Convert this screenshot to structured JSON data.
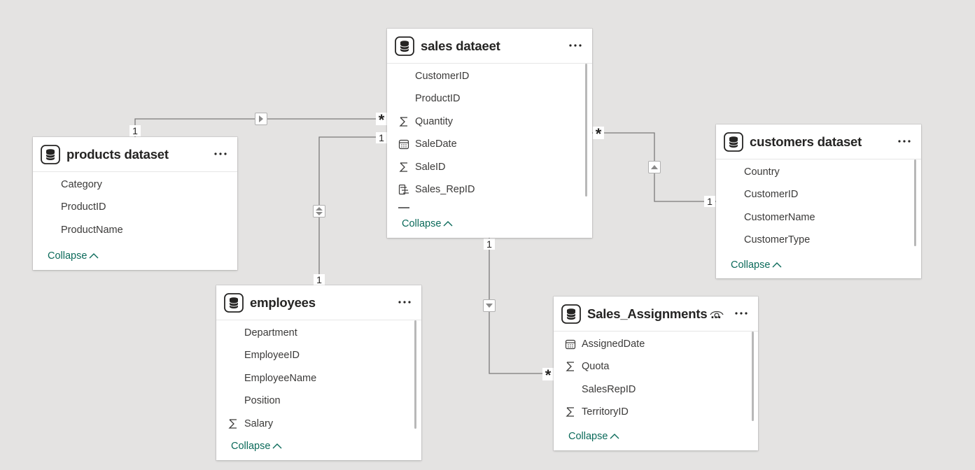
{
  "tables": {
    "products": {
      "title": "products dataset",
      "fields": [
        {
          "name": "Category",
          "icon": "none"
        },
        {
          "name": "ProductID",
          "icon": "none"
        },
        {
          "name": "ProductName",
          "icon": "none"
        }
      ],
      "collapse_label": "Collapse"
    },
    "sales": {
      "title": "sales dataeet",
      "fields": [
        {
          "name": "CustomerID",
          "icon": "none"
        },
        {
          "name": "ProductID",
          "icon": "none"
        },
        {
          "name": "Quantity",
          "icon": "sigma-icon"
        },
        {
          "name": "SaleDate",
          "icon": "calendar-icon"
        },
        {
          "name": "SaleID",
          "icon": "sigma-icon"
        },
        {
          "name": "Sales_RepID",
          "icon": "hierarchy-icon"
        }
      ],
      "collapse_label": "Collapse"
    },
    "customers": {
      "title": "customers dataset",
      "fields": [
        {
          "name": "Country",
          "icon": "none"
        },
        {
          "name": "CustomerID",
          "icon": "none"
        },
        {
          "name": "CustomerName",
          "icon": "none"
        },
        {
          "name": "CustomerType",
          "icon": "none"
        }
      ],
      "collapse_label": "Collapse"
    },
    "employees": {
      "title": "employees",
      "fields": [
        {
          "name": "Department",
          "icon": "none"
        },
        {
          "name": "EmployeeID",
          "icon": "none"
        },
        {
          "name": "EmployeeName",
          "icon": "none"
        },
        {
          "name": "Position",
          "icon": "none"
        },
        {
          "name": "Salary",
          "icon": "sigma-icon"
        }
      ],
      "collapse_label": "Collapse"
    },
    "sales_assignments": {
      "title": "Sales_Assignments ...",
      "fields": [
        {
          "name": "AssignedDate",
          "icon": "calendar-icon"
        },
        {
          "name": "Quota",
          "icon": "sigma-icon"
        },
        {
          "name": "SalesRepID",
          "icon": "none"
        },
        {
          "name": "TerritoryID",
          "icon": "sigma-icon"
        }
      ],
      "collapse_label": "Collapse"
    }
  },
  "relationships": {
    "products_sales": {
      "one": "1",
      "many": "*"
    },
    "employees_sales": {
      "one_a": "1",
      "one_b": "1"
    },
    "sales_customers": {
      "many": "*",
      "one": "1"
    },
    "sales_assignments": {
      "one": "1",
      "many": "*"
    }
  },
  "colors": {
    "background": "#e4e3e2",
    "card": "#ffffff",
    "collapse_link": "#0b6a5a",
    "line": "#7a7a7a"
  }
}
